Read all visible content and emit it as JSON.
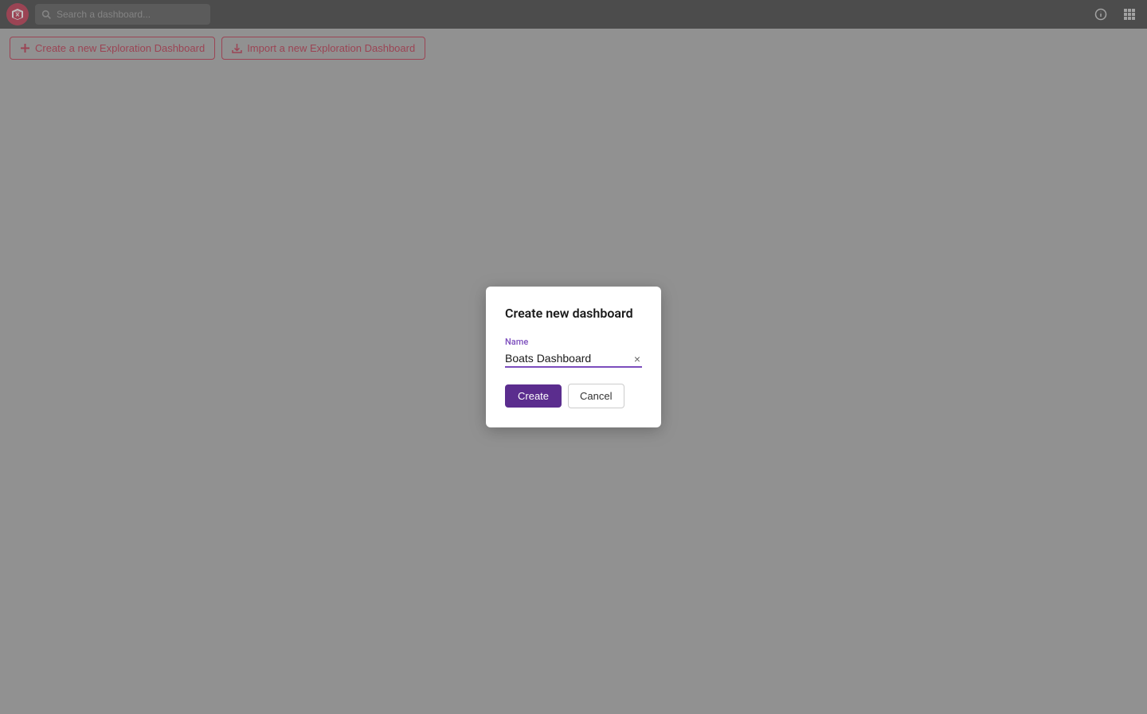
{
  "topBar": {
    "searchPlaceholder": "Search a dashboard...",
    "infoIconLabel": "ℹ",
    "appsIconLabel": "⊞"
  },
  "actionBar": {
    "createBtn": {
      "label": "Create a new Exploration Dashboard",
      "icon": "plus-icon"
    },
    "importBtn": {
      "label": "Import a new Exploration Dashboard",
      "icon": "import-icon"
    }
  },
  "modal": {
    "title": "Create new dashboard",
    "nameLabel": "Name",
    "nameValue": "Boats Dashboard",
    "createBtn": "Create",
    "cancelBtn": "Cancel"
  }
}
